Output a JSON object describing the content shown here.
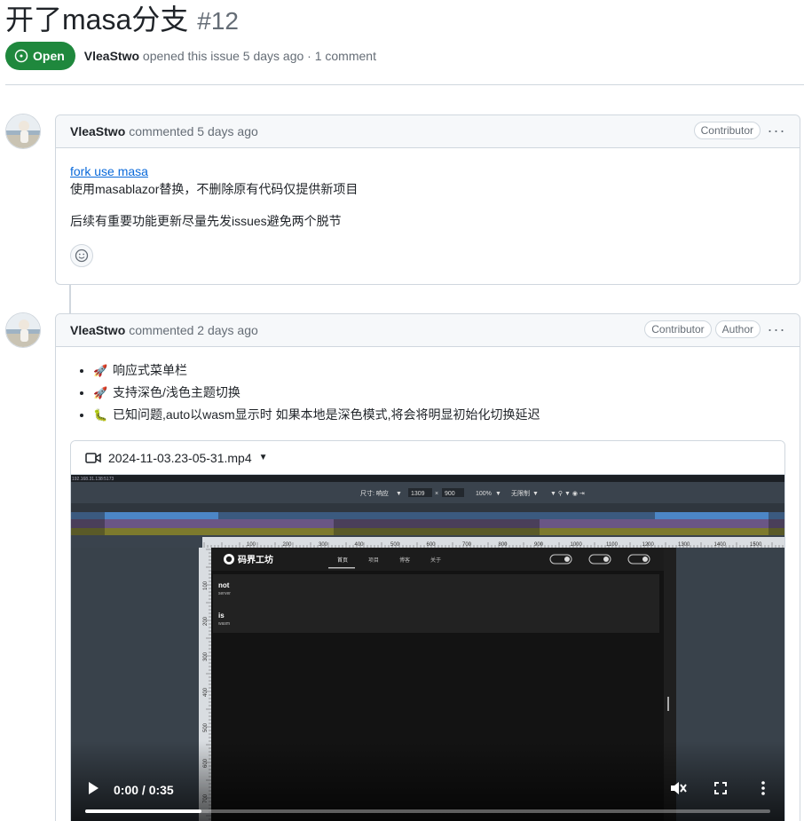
{
  "issue": {
    "title": "开了masa分支",
    "number": "#12",
    "state": "Open",
    "author": "VleaStwo",
    "meta": "opened this issue 5 days ago · 1 comment"
  },
  "comments": [
    {
      "author": "VleaStwo",
      "time": "commented 5 days ago",
      "labels": [
        "Contributor"
      ],
      "link_text": "fork use masa",
      "line1": "使用masablazor替换，不删除原有代码仅提供新项目",
      "line2": "后续有重要功能更新尽量先发issues避免两个脱节"
    },
    {
      "author": "VleaStwo",
      "time": "commented 2 days ago",
      "labels": [
        "Contributor",
        "Author"
      ],
      "items": [
        {
          "icon": "rocket-icon",
          "text": "响应式菜单栏"
        },
        {
          "icon": "rocket-icon",
          "text": "支持深色/浅色主题切换"
        },
        {
          "icon": "bug-icon",
          "text": "已知问题,auto以wasm显示时 如果本地是深色模式,将会将明显初始化切换延迟"
        }
      ],
      "video": {
        "filename": "2024-11-03.23-05-31.mp4",
        "url_bar": "192.168.31.138:5173",
        "size_label": "尺寸: 响应",
        "width": "1309",
        "x": "×",
        "height": "900",
        "zoom": "100%",
        "throttle": "无限制",
        "ruler_labels": [
          "100",
          "200",
          "300",
          "400",
          "500",
          "600",
          "700",
          "800",
          "900",
          "1000",
          "1100",
          "1200",
          "1300",
          "1400",
          "1500",
          "1600"
        ],
        "ruler_v_labels": [
          "100",
          "200",
          "300",
          "400",
          "500",
          "600",
          "700"
        ],
        "site_name": "码界工坊",
        "nav": [
          "首页",
          "项目",
          "博客",
          "关于"
        ],
        "card_lines": [
          {
            "title": "not",
            "sub": "server"
          },
          {
            "title": "is",
            "sub": "wasm"
          }
        ],
        "time": "0:00 / 0:35",
        "progress": 0.17
      }
    }
  ],
  "colors": {
    "open_green": "#1f883d",
    "link_blue": "#0969da",
    "border": "#d0d7de"
  }
}
